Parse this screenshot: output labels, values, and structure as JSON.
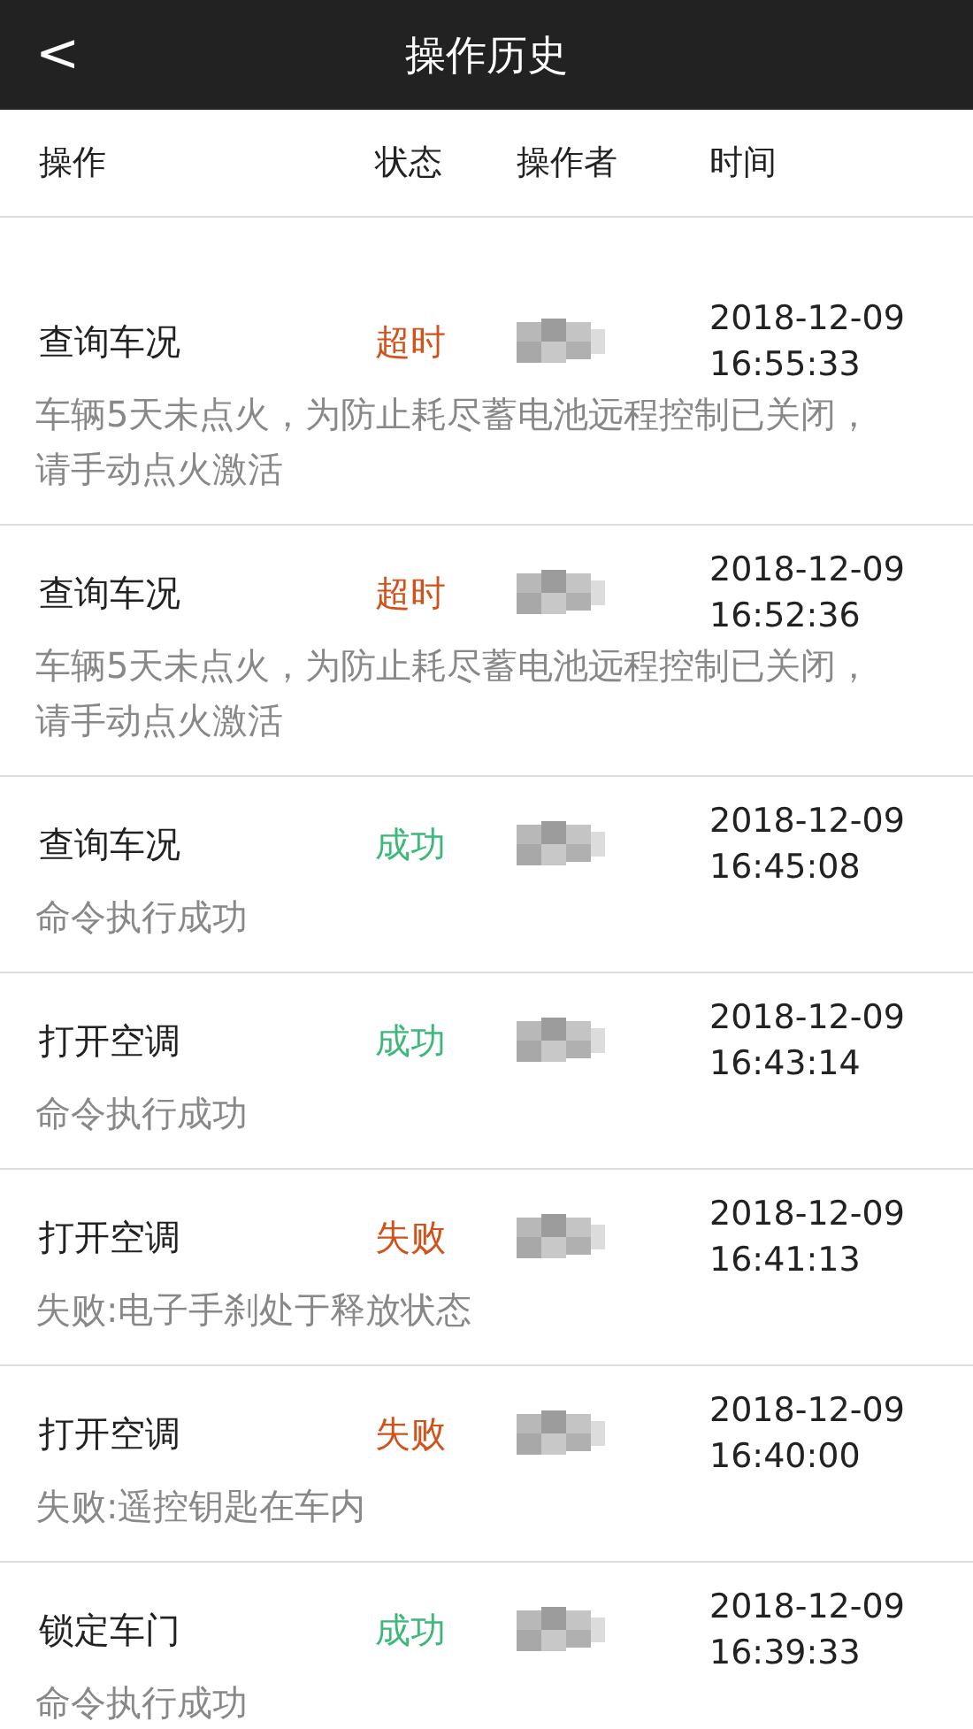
{
  "header": {
    "back": "<",
    "title": "操作历史"
  },
  "columns": [
    "操作",
    "状态",
    "操作者",
    "时间"
  ],
  "rows": [
    {
      "operation": "查询车况",
      "status": "超时",
      "kind": "timeout",
      "operator_redacted": true,
      "date": "2018-12-09",
      "time": "16:55:33",
      "message": "车辆5天未点火，为防止耗尽蓄电池远程控制已关闭，请手动点火激活"
    },
    {
      "operation": "查询车况",
      "status": "超时",
      "kind": "timeout",
      "operator_redacted": true,
      "date": "2018-12-09",
      "time": "16:52:36",
      "message": "车辆5天未点火，为防止耗尽蓄电池远程控制已关闭，请手动点火激活"
    },
    {
      "operation": "查询车况",
      "status": "成功",
      "kind": "success",
      "operator_redacted": true,
      "date": "2018-12-09",
      "time": "16:45:08",
      "message": "命令执行成功"
    },
    {
      "operation": "打开空调",
      "status": "成功",
      "kind": "success",
      "operator_redacted": true,
      "date": "2018-12-09",
      "time": "16:43:14",
      "message": "命令执行成功"
    },
    {
      "operation": "打开空调",
      "status": "失败",
      "kind": "failure",
      "operator_redacted": true,
      "date": "2018-12-09",
      "time": "16:41:13",
      "message": "失败:电子手刹处于释放状态"
    },
    {
      "operation": "打开空调",
      "status": "失败",
      "kind": "failure",
      "operator_redacted": true,
      "date": "2018-12-09",
      "time": "16:40:00",
      "message": "失败:遥控钥匙在车内"
    },
    {
      "operation": "锁定车门",
      "status": "成功",
      "kind": "success",
      "operator_redacted": true,
      "date": "2018-12-09",
      "time": "16:39:33",
      "message": "命令执行成功"
    }
  ]
}
